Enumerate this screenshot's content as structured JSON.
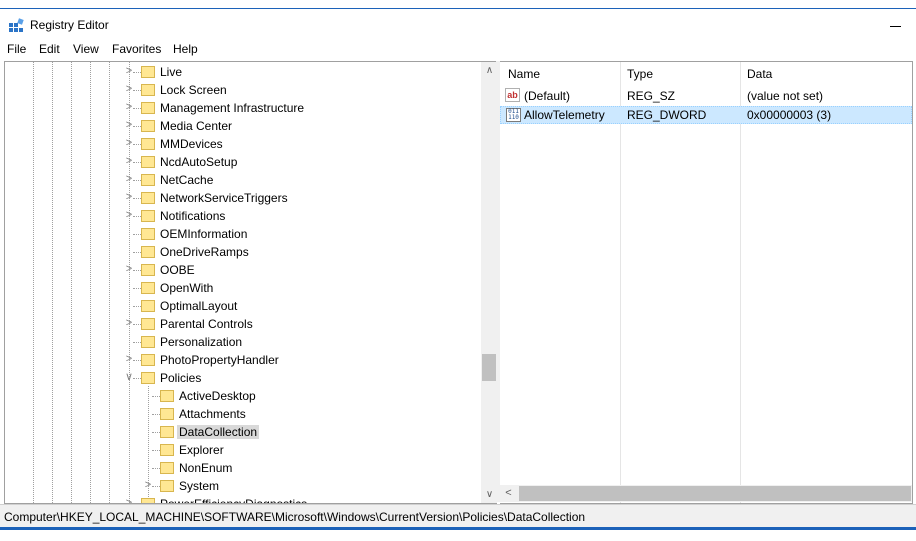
{
  "window": {
    "title": "Registry Editor"
  },
  "menu": [
    "File",
    "Edit",
    "View",
    "Favorites",
    "Help"
  ],
  "tree": {
    "items": [
      {
        "label": "Live",
        "expander": "collapsed",
        "depth": 0
      },
      {
        "label": "Lock Screen",
        "expander": "collapsed",
        "depth": 0
      },
      {
        "label": "Management Infrastructure",
        "expander": "collapsed",
        "depth": 0
      },
      {
        "label": "Media Center",
        "expander": "collapsed",
        "depth": 0
      },
      {
        "label": "MMDevices",
        "expander": "collapsed",
        "depth": 0
      },
      {
        "label": "NcdAutoSetup",
        "expander": "collapsed",
        "depth": 0
      },
      {
        "label": "NetCache",
        "expander": "collapsed",
        "depth": 0
      },
      {
        "label": "NetworkServiceTriggers",
        "expander": "collapsed",
        "depth": 0
      },
      {
        "label": "Notifications",
        "expander": "collapsed",
        "depth": 0
      },
      {
        "label": "OEMInformation",
        "expander": "none",
        "depth": 0
      },
      {
        "label": "OneDriveRamps",
        "expander": "none",
        "depth": 0
      },
      {
        "label": "OOBE",
        "expander": "collapsed",
        "depth": 0
      },
      {
        "label": "OpenWith",
        "expander": "none",
        "depth": 0
      },
      {
        "label": "OptimalLayout",
        "expander": "none",
        "depth": 0
      },
      {
        "label": "Parental Controls",
        "expander": "collapsed",
        "depth": 0
      },
      {
        "label": "Personalization",
        "expander": "none",
        "depth": 0
      },
      {
        "label": "PhotoPropertyHandler",
        "expander": "collapsed",
        "depth": 0
      },
      {
        "label": "Policies",
        "expander": "expanded",
        "depth": 0
      },
      {
        "label": "ActiveDesktop",
        "expander": "none",
        "depth": 1
      },
      {
        "label": "Attachments",
        "expander": "none",
        "depth": 1
      },
      {
        "label": "DataCollection",
        "expander": "none",
        "depth": 1,
        "selected": true
      },
      {
        "label": "Explorer",
        "expander": "none",
        "depth": 1
      },
      {
        "label": "NonEnum",
        "expander": "none",
        "depth": 1
      },
      {
        "label": "System",
        "expander": "collapsed",
        "depth": 1
      },
      {
        "label": "PowerEfficiencyDiagnostics",
        "expander": "collapsed",
        "depth": 0
      }
    ]
  },
  "values_list": {
    "columns": [
      "Name",
      "Type",
      "Data"
    ],
    "rows": [
      {
        "icon": "string-value-icon",
        "name": "(Default)",
        "type": "REG_SZ",
        "data": "(value not set)",
        "selected": false
      },
      {
        "icon": "binary-value-icon",
        "name": "AllowTelemetry",
        "type": "REG_DWORD",
        "data": "0x00000003 (3)",
        "selected": true
      }
    ]
  },
  "status": {
    "path": "Computer\\HKEY_LOCAL_MACHINE\\SOFTWARE\\Microsoft\\Windows\\CurrentVersion\\Policies\\DataCollection"
  },
  "colors": {
    "accent": "#1c62b9",
    "selection": "#cce8ff",
    "folder": "#ffe793"
  }
}
